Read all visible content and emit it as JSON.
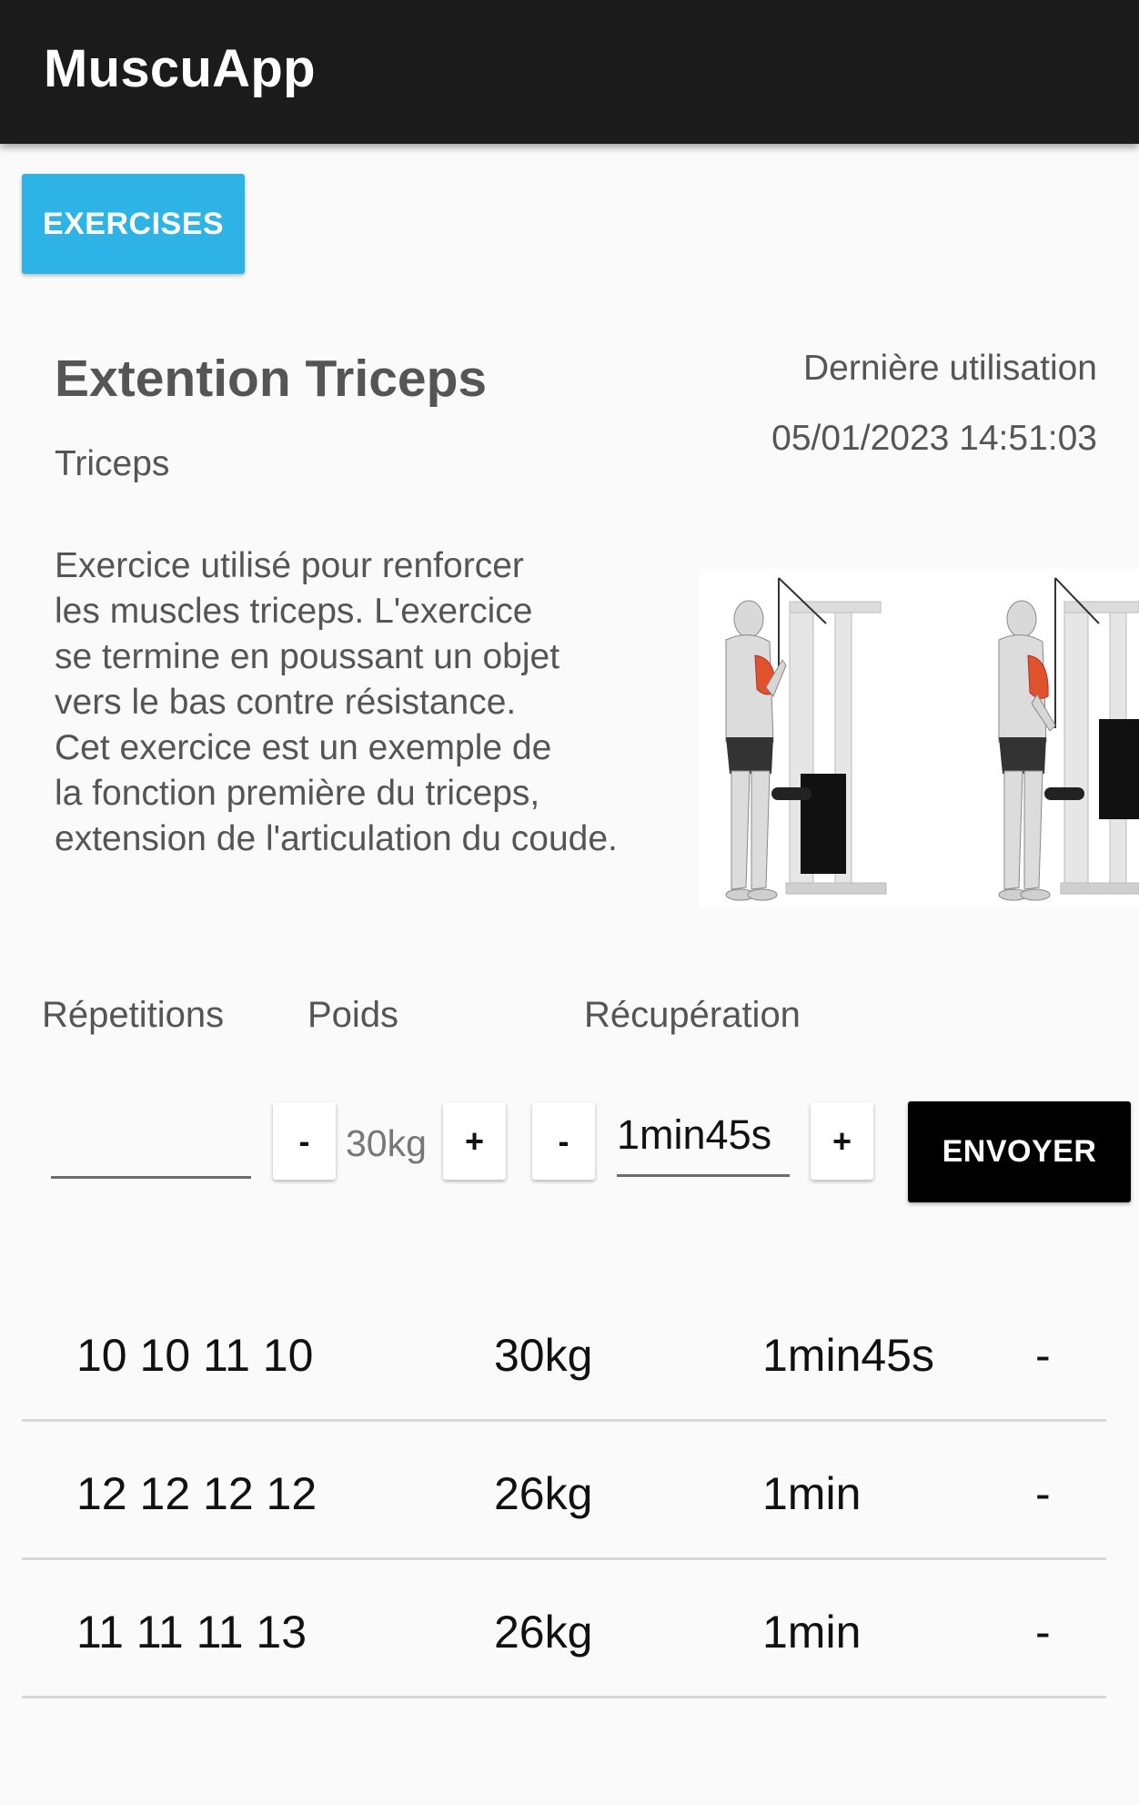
{
  "app": {
    "title": "MuscuApp"
  },
  "toolbar": {
    "exercises_label": "EXERCISES"
  },
  "exercise": {
    "name": "Extention Triceps",
    "muscle": "Triceps",
    "last_use_label": "Dernière utilisation",
    "last_use_date": "05/01/2023 14:51:03",
    "description_lines": [
      "Exercice utilisé pour renforcer",
      "les muscles triceps. L'exercice",
      "se termine en poussant un objet",
      "vers le bas contre résistance.",
      "Cet exercice est un exemple de",
      "la fonction première du triceps,",
      "extension de l'articulation du coude."
    ]
  },
  "form": {
    "reps_label": "Répetitions",
    "weight_label": "Poids",
    "rest_label": "Récupération",
    "reps_value": "",
    "weight_value": "30kg",
    "rest_value": "1min45s",
    "minus_label": "-",
    "plus_label": "+",
    "send_label": "ENVOYER"
  },
  "history": [
    {
      "reps": "10 10 11 10",
      "weight": "30kg",
      "rest": "1min45s",
      "action": "-"
    },
    {
      "reps": "12 12 12 12",
      "weight": "26kg",
      "rest": "1min",
      "action": "-"
    },
    {
      "reps": "11 11 11 13",
      "weight": "26kg",
      "rest": "1min",
      "action": "-"
    }
  ],
  "colors": {
    "appbar": "#1b1b1b",
    "accent": "#2eb3e6",
    "send_button": "#000000",
    "highlight_muscle": "#e0522b"
  }
}
